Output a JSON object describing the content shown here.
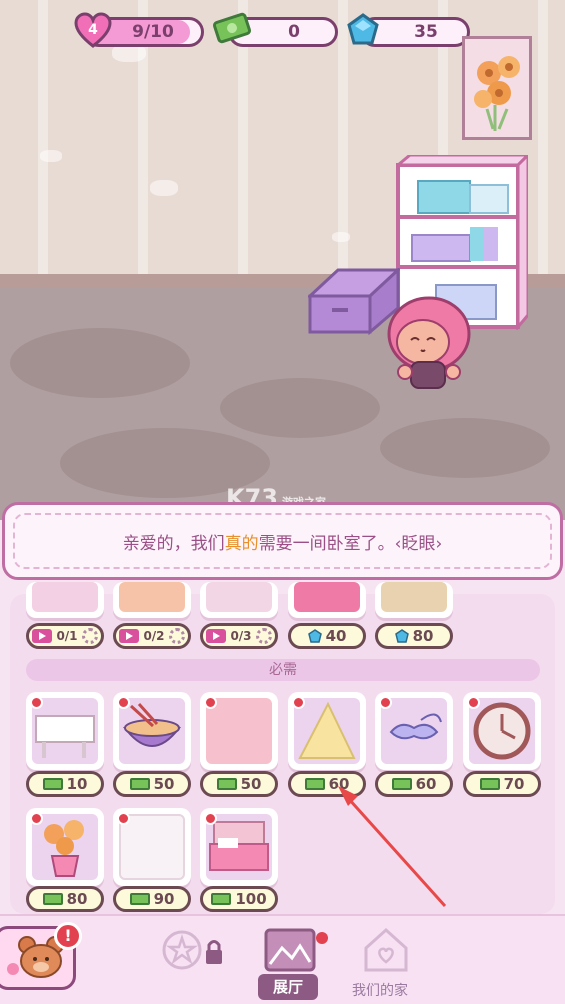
{
  "hud": {
    "hearts_level": "4",
    "hearts": "9/10",
    "hearts_fraction": 0.9,
    "cash": "0",
    "gems": "35"
  },
  "watermark": {
    "text": "K73",
    "sub": "游戏之家"
  },
  "dialog": {
    "before": "亲爱的，我们",
    "highlight": "真的",
    "after": "需要一间卧室了。‹眨眼›"
  },
  "shop": {
    "top_row": [
      {
        "kind": "ad",
        "label": "0/1"
      },
      {
        "kind": "ad",
        "label": "0/2"
      },
      {
        "kind": "ad",
        "label": "0/3"
      },
      {
        "kind": "gem",
        "label": "40"
      },
      {
        "kind": "gem",
        "label": "80"
      }
    ],
    "section_title": "必需",
    "items": [
      {
        "name": "table",
        "price": "10"
      },
      {
        "name": "noodle-bowl",
        "price": "50"
      },
      {
        "name": "pink-rug",
        "price": "50"
      },
      {
        "name": "yellow-rug",
        "price": "60"
      },
      {
        "name": "sleep-mask",
        "price": "60"
      },
      {
        "name": "wall-clock",
        "price": "70"
      },
      {
        "name": "flower-vase",
        "price": "80"
      },
      {
        "name": "white-rug",
        "price": "90"
      },
      {
        "name": "pink-bed",
        "price": "100"
      }
    ]
  },
  "nav": {
    "alert": "!",
    "tabs": [
      {
        "label": "",
        "locked": true
      },
      {
        "label": "展厅",
        "active": true
      },
      {
        "label": "我们的家"
      }
    ]
  },
  "colors": {
    "accent": "#bf6ea3",
    "alert": "#e2424f",
    "cash": "#77c35a",
    "gem": "#4fb9e6"
  }
}
